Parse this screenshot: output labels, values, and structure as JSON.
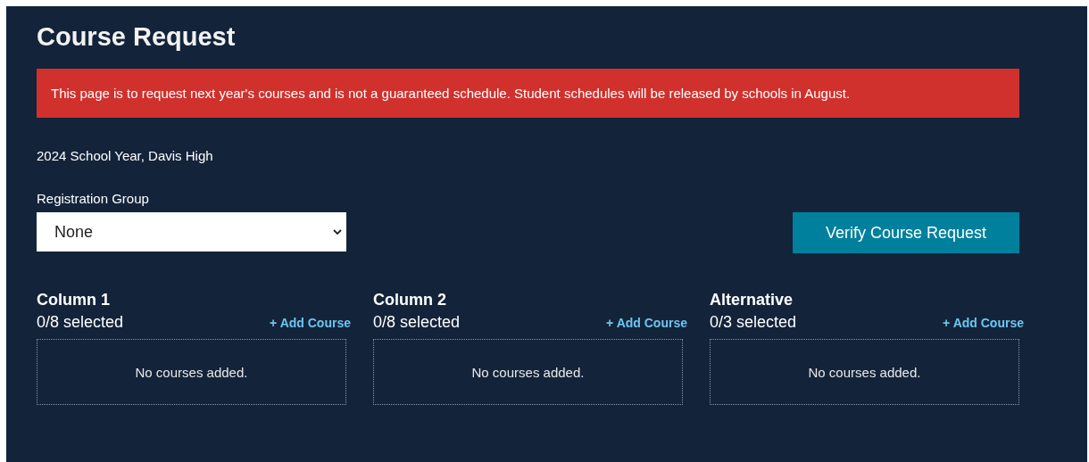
{
  "title": "Course Request",
  "alert": "This page is to request next year's courses and is not a guaranteed schedule. Student schedules will be released by schools in August.",
  "school_year": "2024 School Year, Davis High",
  "registration_group": {
    "label": "Registration Group",
    "value": "None"
  },
  "verify_button": "Verify Course Request",
  "columns": [
    {
      "title": "Column 1",
      "count": "0/8 selected",
      "add": "+ Add Course",
      "empty": "No courses added."
    },
    {
      "title": "Column 2",
      "count": "0/8 selected",
      "add": "+ Add Course",
      "empty": "No courses added."
    },
    {
      "title": "Alternative",
      "count": "0/3 selected",
      "add": "+ Add Course",
      "empty": "No courses added."
    }
  ]
}
